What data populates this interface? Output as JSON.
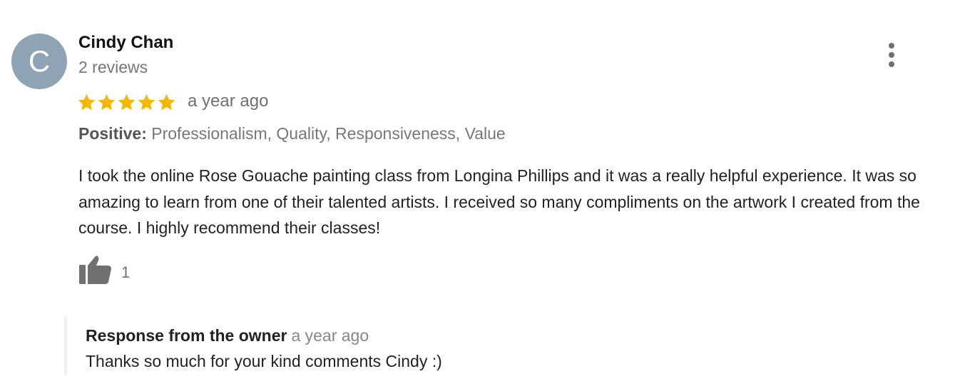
{
  "reviewer": {
    "initial": "C",
    "name": "Cindy Chan",
    "reviews_count": "2 reviews",
    "avatar_color": "#8ea4b4"
  },
  "rating": {
    "stars": 5,
    "max_stars": 5,
    "star_color": "#f5b800",
    "date": "a year ago"
  },
  "attributes": {
    "label": "Positive:",
    "values": "Professionalism, Quality, Responsiveness, Value"
  },
  "review": {
    "text": "I took the online Rose Gouache painting class from Longina Phillips and it was a really helpful experience. It was so amazing to learn from one of their talented artists. I received so many compliments on the artwork I created from the course. I highly recommend their classes!"
  },
  "likes": {
    "icon": "thumbs-up-icon",
    "count": "1"
  },
  "menu": {
    "icon": "more-vertical-icon"
  },
  "owner_response": {
    "title": "Response from the owner",
    "date": "a year ago",
    "text": "Thanks so much for your kind comments Cindy :)"
  }
}
